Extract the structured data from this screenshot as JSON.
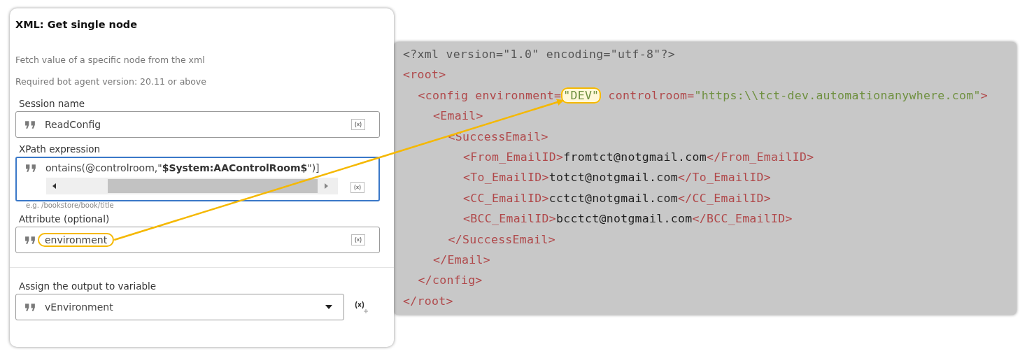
{
  "panel": {
    "title": "XML: Get single node",
    "description": [
      "Fetch value of a specific node from the xml",
      "Required bot agent version: 20.11 or above"
    ],
    "fields": [
      {
        "label": "Session name",
        "value": "ReadConfig",
        "kind": "text",
        "focused": false,
        "highlighted": false
      },
      {
        "label": "XPath expression",
        "value": "ontains(@controlroom,\"**$System:AAControlRoom$**\")]",
        "kind": "scroll",
        "hint": "e.g. /bookstore/book/title",
        "focused": true,
        "highlighted": false
      },
      {
        "label": "Attribute (optional)",
        "value": "environment",
        "kind": "text",
        "focused": false,
        "highlighted": true
      }
    ],
    "output": {
      "label": "Assign the output to variable",
      "value": "vEnvironment"
    }
  },
  "code": {
    "lines": [
      {
        "tokens": [
          {
            "kind": "decl",
            "text": "<?xml version=\"1.0\" encoding=\"utf-8\"?>"
          }
        ]
      },
      {
        "tokens": [
          {
            "kind": "tag",
            "text": "<root>"
          }
        ],
        "children": [
          {
            "tokens": [
              {
                "kind": "tag",
                "text": "<config environment="
              },
              {
                "kind": "value",
                "text": "\"DEV\"",
                "highlighted": true
              },
              {
                "kind": "tag",
                "text": " controlroom="
              },
              {
                "kind": "value",
                "text": "\"https:\\\\tct-dev.automationanywhere.com\""
              },
              {
                "kind": "tag",
                "text": ">"
              }
            ],
            "children": [
              {
                "tokens": [
                  {
                    "kind": "tag",
                    "text": "<Email>"
                  }
                ],
                "children": [
                  {
                    "tokens": [
                      {
                        "kind": "tag",
                        "text": "<SuccessEmail>"
                      }
                    ],
                    "children": [
                      {
                        "tokens": [
                          {
                            "kind": "tag",
                            "text": "<From_EmailID>"
                          },
                          {
                            "kind": "text",
                            "text": "fromtct@notgmail.com"
                          },
                          {
                            "kind": "tag",
                            "text": "</From_EmailID>"
                          }
                        ]
                      },
                      {
                        "tokens": [
                          {
                            "kind": "tag",
                            "text": "<To_EmailID>"
                          },
                          {
                            "kind": "text",
                            "text": "totct@notgmail.com"
                          },
                          {
                            "kind": "tag",
                            "text": "</To_EmailID>"
                          }
                        ]
                      },
                      {
                        "tokens": [
                          {
                            "kind": "tag",
                            "text": "<CC_EmailID>"
                          },
                          {
                            "kind": "text",
                            "text": "cctct@notgmail.com"
                          },
                          {
                            "kind": "tag",
                            "text": "</CC_EmailID>"
                          }
                        ]
                      },
                      {
                        "tokens": [
                          {
                            "kind": "tag",
                            "text": "<BCC_EmailID>"
                          },
                          {
                            "kind": "text",
                            "text": "bcctct@notgmail.com"
                          },
                          {
                            "kind": "tag",
                            "text": "</BCC_EmailID>"
                          }
                        ]
                      }
                    ]
                  },
                  {
                    "tokens": [
                      {
                        "kind": "tag",
                        "text": "</SuccessEmail>"
                      }
                    ]
                  }
                ]
              },
              {
                "tokens": [
                  {
                    "kind": "tag",
                    "text": "</Email>"
                  }
                ]
              }
            ]
          },
          {
            "tokens": [
              {
                "kind": "tag",
                "text": "</config>"
              }
            ]
          }
        ]
      },
      {
        "tokens": [
          {
            "kind": "tag",
            "text": "</root>"
          }
        ]
      }
    ]
  }
}
